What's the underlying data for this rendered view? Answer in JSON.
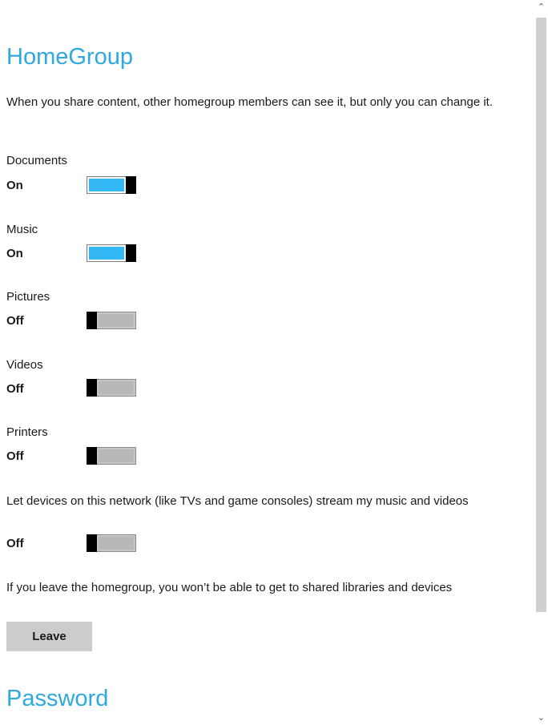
{
  "homegroup": {
    "title": "HomeGroup",
    "description": "When you share content, other homegroup members can see it, but only you can change it."
  },
  "settings": [
    {
      "label": "Documents",
      "state": "On",
      "enabled": true
    },
    {
      "label": "Music",
      "state": "On",
      "enabled": true
    },
    {
      "label": "Pictures",
      "state": "Off",
      "enabled": false
    },
    {
      "label": "Videos",
      "state": "Off",
      "enabled": false
    },
    {
      "label": "Printers",
      "state": "Off",
      "enabled": false
    },
    {
      "label": "Let devices on this network (like TVs and game consoles) stream my music and videos",
      "state": "Off",
      "enabled": false
    }
  ],
  "leave": {
    "description": "If you leave the homegroup, you won’t be able to get to shared libraries and devices",
    "button_label": "Leave"
  },
  "password": {
    "title": "Password"
  },
  "scrollbar": {
    "up_icon": "chevron-up-icon",
    "down_icon": "chevron-down-icon"
  },
  "colors": {
    "accent": "#2ea8e0",
    "toggle_on": "#34b8f5",
    "toggle_off": "#b8b8b8",
    "button_bg": "#cccccc"
  }
}
